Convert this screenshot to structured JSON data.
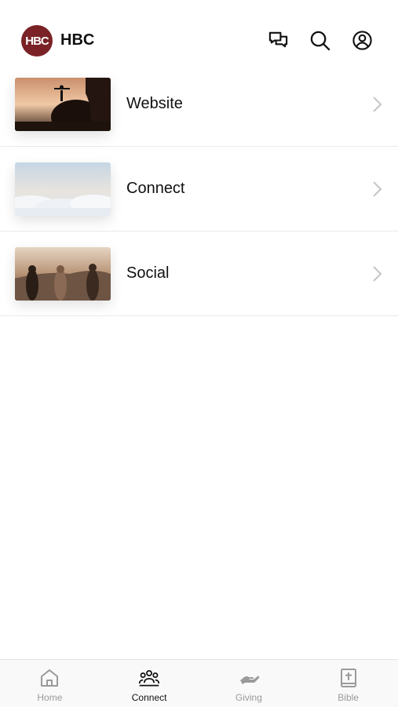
{
  "header": {
    "logo_text": "HBC",
    "title": "HBC",
    "icons": [
      "chat-bubbles-icon",
      "search-icon",
      "account-icon"
    ]
  },
  "list": {
    "items": [
      {
        "label": "Website",
        "thumbnail": "person-on-rock-sunset-image"
      },
      {
        "label": "Connect",
        "thumbnail": "clouds-sky-image"
      },
      {
        "label": "Social",
        "thumbnail": "friends-sunset-image"
      }
    ]
  },
  "tabs": [
    {
      "label": "Home",
      "icon": "home-icon",
      "active": false
    },
    {
      "label": "Connect",
      "icon": "people-group-icon",
      "active": true
    },
    {
      "label": "Giving",
      "icon": "giving-hand-icon",
      "active": false
    },
    {
      "label": "Bible",
      "icon": "bible-icon",
      "active": false
    }
  ],
  "colors": {
    "brand": "#7a2226",
    "active_tab": "#111111",
    "inactive_tab": "#9a9a9a",
    "divider": "#e9e9e9"
  }
}
